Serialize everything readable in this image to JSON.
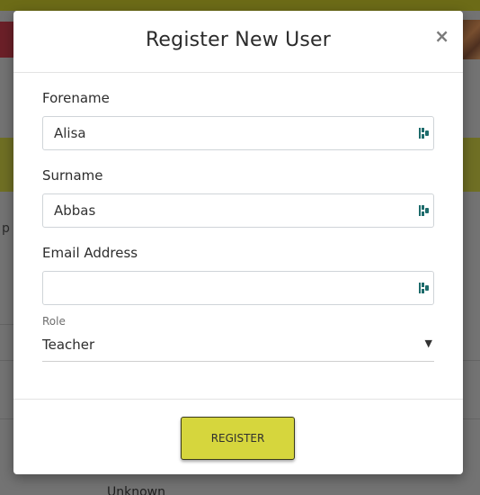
{
  "modal": {
    "title": "Register New User",
    "close_label": "×"
  },
  "form": {
    "forename": {
      "label": "Forename",
      "value": "Alisa",
      "placeholder": ""
    },
    "surname": {
      "label": "Surname",
      "value": "Abbas",
      "placeholder": ""
    },
    "email": {
      "label": "Email Address",
      "value": "",
      "placeholder": ""
    },
    "role": {
      "label": "Role",
      "selected": "Teacher",
      "caret": "▼"
    }
  },
  "footer": {
    "register_label": "REGISTER"
  },
  "background": {
    "partial_text": "p",
    "cell_text": "Unknown"
  },
  "icons": {
    "field_icon": "password-manager-icon",
    "close": "close-icon",
    "caret": "caret-down-icon"
  },
  "colors": {
    "accent": "#d6d63d",
    "field_icon": "#1d6b6b",
    "overlay": "#737373"
  }
}
